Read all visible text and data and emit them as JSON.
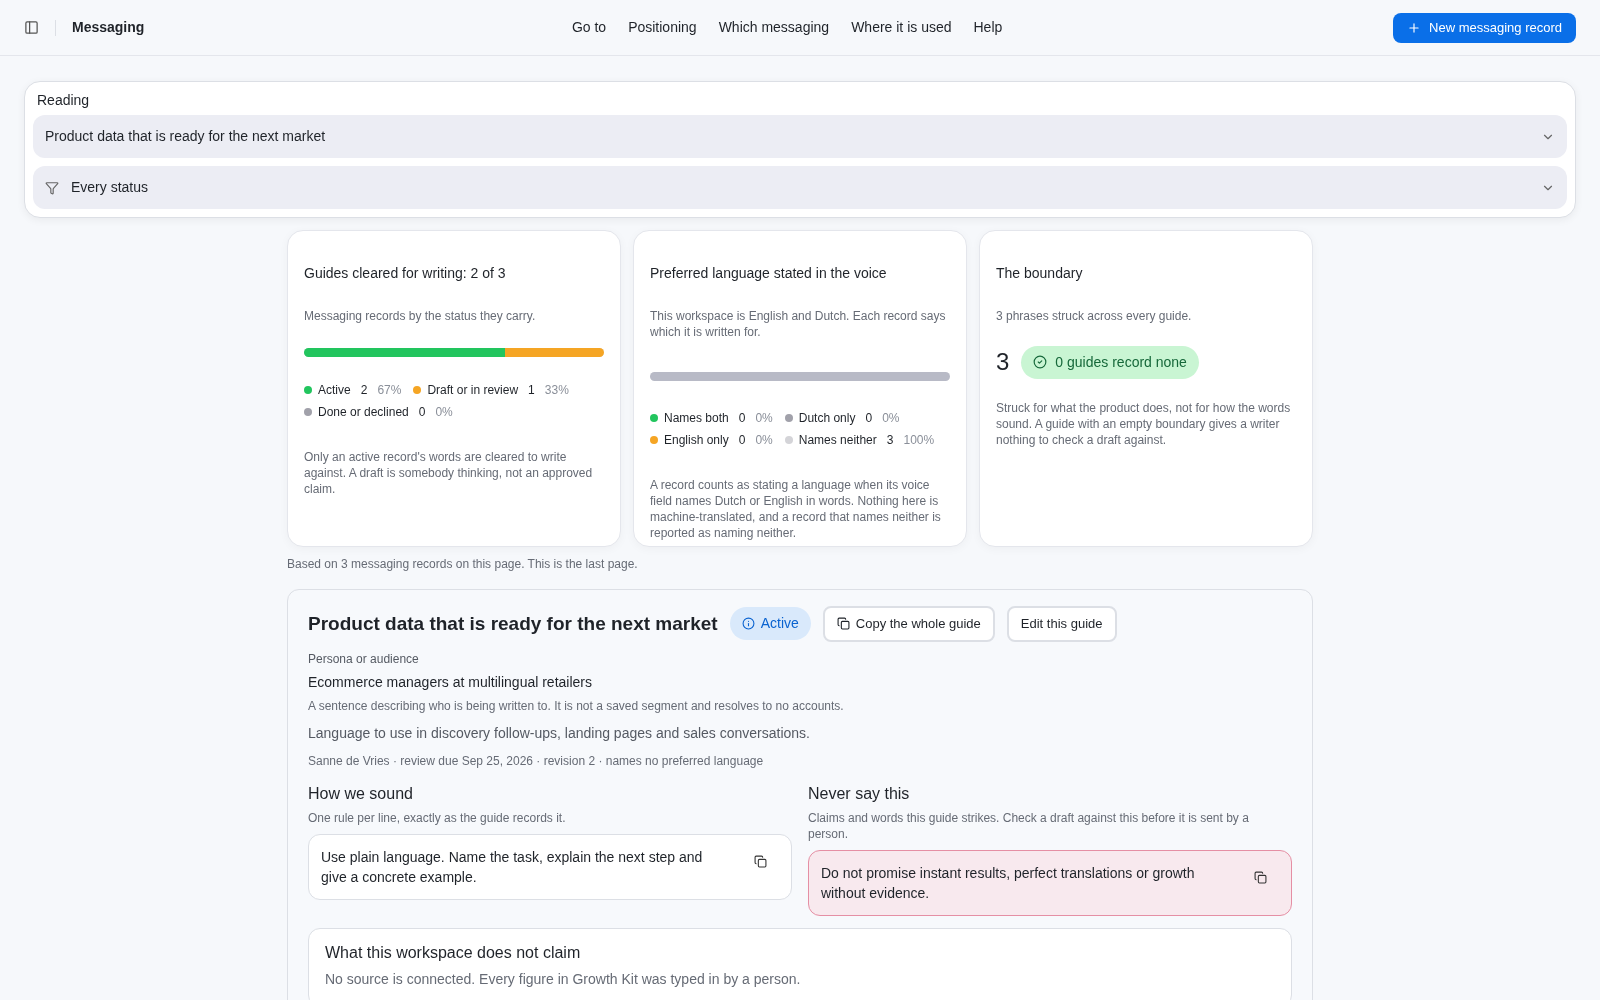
{
  "header": {
    "title": "Messaging",
    "nav": [
      {
        "label": "Go to"
      },
      {
        "label": "Positioning"
      },
      {
        "label": "Which messaging"
      },
      {
        "label": "Where it is used"
      },
      {
        "label": "Help"
      }
    ],
    "new_button": "New messaging record"
  },
  "reading": {
    "label": "Reading",
    "guide_select": "Product data that is ready for the next market",
    "status_select": "Every status"
  },
  "cards": [
    {
      "kind": "status",
      "title": "Guides cleared for writing: 2 of 3",
      "subtitle": "Messaging records by the status they carry.",
      "segments": [
        {
          "level": 0.67,
          "color": "#22c55e"
        },
        {
          "level": 0.33,
          "color": "#f5a524"
        }
      ],
      "legend": [
        {
          "label": "Active",
          "count": "2",
          "percent": "67%",
          "color": "#22c55e"
        },
        {
          "label": "Draft or in review",
          "count": "1",
          "percent": "33%",
          "color": "#f5a524"
        },
        {
          "label": "Done or declined",
          "count": "0",
          "percent": "0%",
          "color": "#a1a1aa"
        }
      ],
      "note": "Only an active record's words are cleared to write against. A draft is somebody thinking, not an approved claim."
    },
    {
      "kind": "status",
      "title": "Preferred language stated in the voice",
      "subtitle": "This workspace is English and Dutch. Each record says which it is written for.",
      "segments": [
        {
          "level": 1,
          "color": "#b8bac6"
        }
      ],
      "legend": [
        {
          "label": "Names both",
          "count": "0",
          "percent": "0%",
          "color": "#22c55e"
        },
        {
          "label": "Dutch only",
          "count": "0",
          "percent": "0%",
          "color": "#a1a1aa"
        },
        {
          "label": "English only",
          "count": "0",
          "percent": "0%",
          "color": "#f5a524"
        },
        {
          "label": "Names neither",
          "count": "3",
          "percent": "100%",
          "color": "#d4d4d8"
        }
      ],
      "note": "A record counts as stating a language when its voice field names Dutch or English in words. Nothing here is machine-translated, and a record that names neither is reported as naming neither."
    },
    {
      "kind": "boundary",
      "title": "The boundary",
      "subtitle": "3 phrases struck across every guide.",
      "big": "3",
      "badge": "0 guides record none",
      "note": "Struck for what the product does, not for how the words sound. A guide with an empty boundary gives a writer nothing to check a draft against."
    }
  ],
  "footnote": "Based on 3 messaging records on this page. This is the last page.",
  "guide": {
    "title": "Product data that is ready for the next market",
    "status": "Active",
    "copy_button": "Copy the whole guide",
    "edit_button": "Edit this guide",
    "persona_label": "Persona or audience",
    "persona": "Ecommerce managers at multilingual retailers",
    "persona_hint": "A sentence describing who is being written to. It is not a saved segment and resolves to no accounts.",
    "use": "Language to use in discovery follow-ups, landing pages and sales conversations.",
    "meta": "Sanne de Vries · review due Sep 25, 2026 · revision 2 · names no preferred language",
    "columns": [
      {
        "kind": "voice",
        "title": "How we sound",
        "hint": "One rule per line, exactly as the guide records it.",
        "rule": "Use plain language. Name the task, explain the next step and give a concrete example."
      },
      {
        "kind": "never",
        "title": "Never say this",
        "hint": "Claims and words this guide strikes. Check a draft against this before it is sent by a person.",
        "rule": "Do not promise instant results, perfect translations or growth without evidence."
      }
    ],
    "disclaimer": {
      "title": "What this workspace does not claim",
      "text": "No source is connected. Every figure in Growth Kit was typed in by a person."
    }
  }
}
